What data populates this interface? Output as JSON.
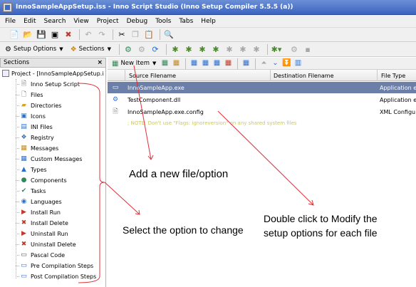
{
  "window": {
    "title": "InnoSampleAppSetup.iss - Inno Script Studio (Inno Setup Compiler 5.5.5 (a))"
  },
  "menu": [
    "File",
    "Edit",
    "Search",
    "View",
    "Project",
    "Debug",
    "Tools",
    "Tabs",
    "Help"
  ],
  "toolbar2": {
    "setup_options": "Setup Options",
    "sections": "Sections"
  },
  "sections_panel": {
    "title": "Sections",
    "close_glyph": "×",
    "root": "Project - [InnoSampleAppSetup.i",
    "items": [
      {
        "label": "Inno Setup Script",
        "icon": "script-icon"
      },
      {
        "label": "Files",
        "icon": "file-icon"
      },
      {
        "label": "Directories",
        "icon": "folder-icon"
      },
      {
        "label": "Icons",
        "icon": "icons-icon"
      },
      {
        "label": "INI Files",
        "icon": "ini-icon"
      },
      {
        "label": "Registry",
        "icon": "registry-icon"
      },
      {
        "label": "Messages",
        "icon": "messages-icon"
      },
      {
        "label": "Custom Messages",
        "icon": "custom-messages-icon"
      },
      {
        "label": "Types",
        "icon": "types-icon"
      },
      {
        "label": "Components",
        "icon": "components-icon"
      },
      {
        "label": "Tasks",
        "icon": "tasks-icon"
      },
      {
        "label": "Languages",
        "icon": "languages-icon"
      },
      {
        "label": "Install Run",
        "icon": "install-run-icon"
      },
      {
        "label": "Install Delete",
        "icon": "install-delete-icon"
      },
      {
        "label": "Uninstall Run",
        "icon": "uninstall-run-icon"
      },
      {
        "label": "Uninstall Delete",
        "icon": "uninstall-delete-icon"
      },
      {
        "label": "Pascal Code",
        "icon": "pascal-code-icon"
      },
      {
        "label": "Pre Compilation Steps",
        "icon": "pre-compilation-icon"
      },
      {
        "label": "Post Compilation Steps",
        "icon": "post-compilation-icon"
      }
    ]
  },
  "files_pane": {
    "new_item": "New Item",
    "columns": [
      "Source Filename",
      "Destination Filename",
      "File Type"
    ],
    "rows": [
      {
        "source": "InnoSampleApp.exe",
        "destination": "",
        "type": "Application e",
        "selected": true
      },
      {
        "source": "TestComponent.dll",
        "destination": "",
        "type": "Application e",
        "selected": false
      },
      {
        "source": "InnoSampleApp.exe.config",
        "destination": "",
        "type": "XML Configu",
        "selected": false
      }
    ],
    "note": "; NOTE: Don't use \"Flags: ignoreversion\" on any shared system files"
  },
  "annotations": {
    "add_new": "Add a new file/option",
    "select_option": "Select the option to change",
    "double_click": "Double click to Modify the setup options for each file"
  },
  "colors": {
    "annotation_line": "#e0303a",
    "selected_row": "#6b7fa8",
    "titlebar": "#3d64c0"
  }
}
